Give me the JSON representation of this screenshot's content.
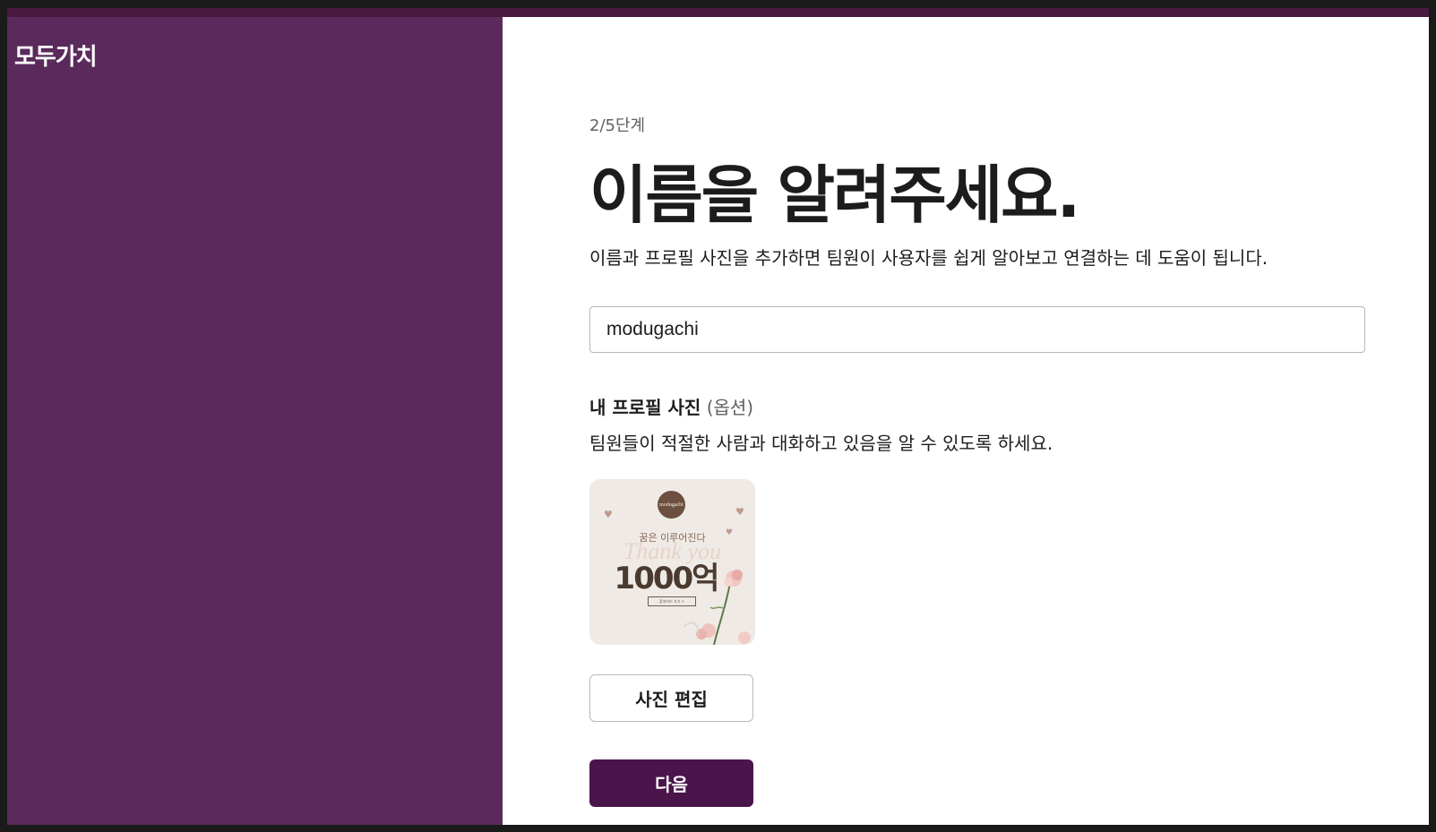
{
  "sidebar": {
    "workspace_name": "모두가치"
  },
  "main": {
    "step_label": "2/5단계",
    "title": "이름을 알려주세요.",
    "subtitle": "이름과 프로필 사진을 추가하면 팀원이 사용자를 쉽게 알아보고 연결하는 데 도움이 됩니다.",
    "name_input": {
      "value": "modugachi",
      "placeholder": ""
    },
    "profile_photo": {
      "heading": "내 프로필 사진",
      "optional_label": "(옵션)",
      "description": "팀원들이 적절한 사람과 대화하고 있음을 알 수 있도록 하세요.",
      "image": {
        "logo_text": "modugachi",
        "tagline": "꿈은 이루어진다",
        "script_text": "Thank you",
        "amount_text": "1000억",
        "button_text": "참여하러 가기 >"
      }
    },
    "edit_photo_label": "사진 편집",
    "next_label": "다음"
  },
  "colors": {
    "sidebar_bg": "#5a2a5c",
    "primary_button": "#4a154b",
    "text_primary": "#1d1c1d",
    "text_secondary": "#616061"
  }
}
